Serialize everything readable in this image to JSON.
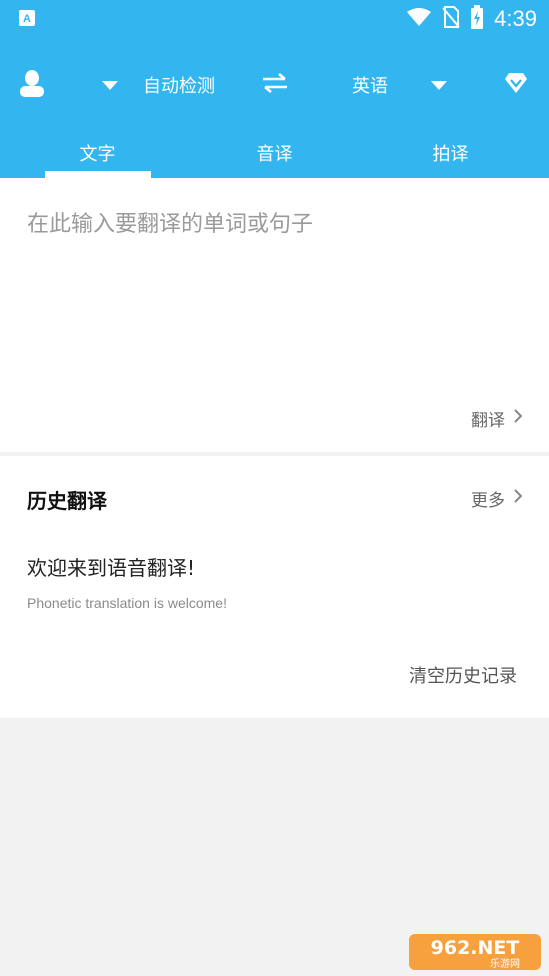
{
  "status_bar": {
    "time": "4:39"
  },
  "toolbar": {
    "source_language": "自动检测",
    "target_language": "英语"
  },
  "tabs": [
    {
      "label": "文字",
      "active": true
    },
    {
      "label": "音译",
      "active": false
    },
    {
      "label": "拍译",
      "active": false
    }
  ],
  "input": {
    "placeholder": "在此输入要翻译的单词或句子",
    "translate_label": "翻译"
  },
  "history": {
    "title": "历史翻译",
    "more_label": "更多",
    "items": [
      {
        "source": "欢迎来到语音翻译!",
        "translation": "Phonetic translation is welcome!"
      }
    ],
    "clear_label": "清空历史记录"
  },
  "watermark": {
    "brand": "962.NET",
    "sub": "乐游网"
  },
  "colors": {
    "primary": "#33b5f0",
    "background": "#f2f2f2",
    "card": "#ffffff"
  }
}
